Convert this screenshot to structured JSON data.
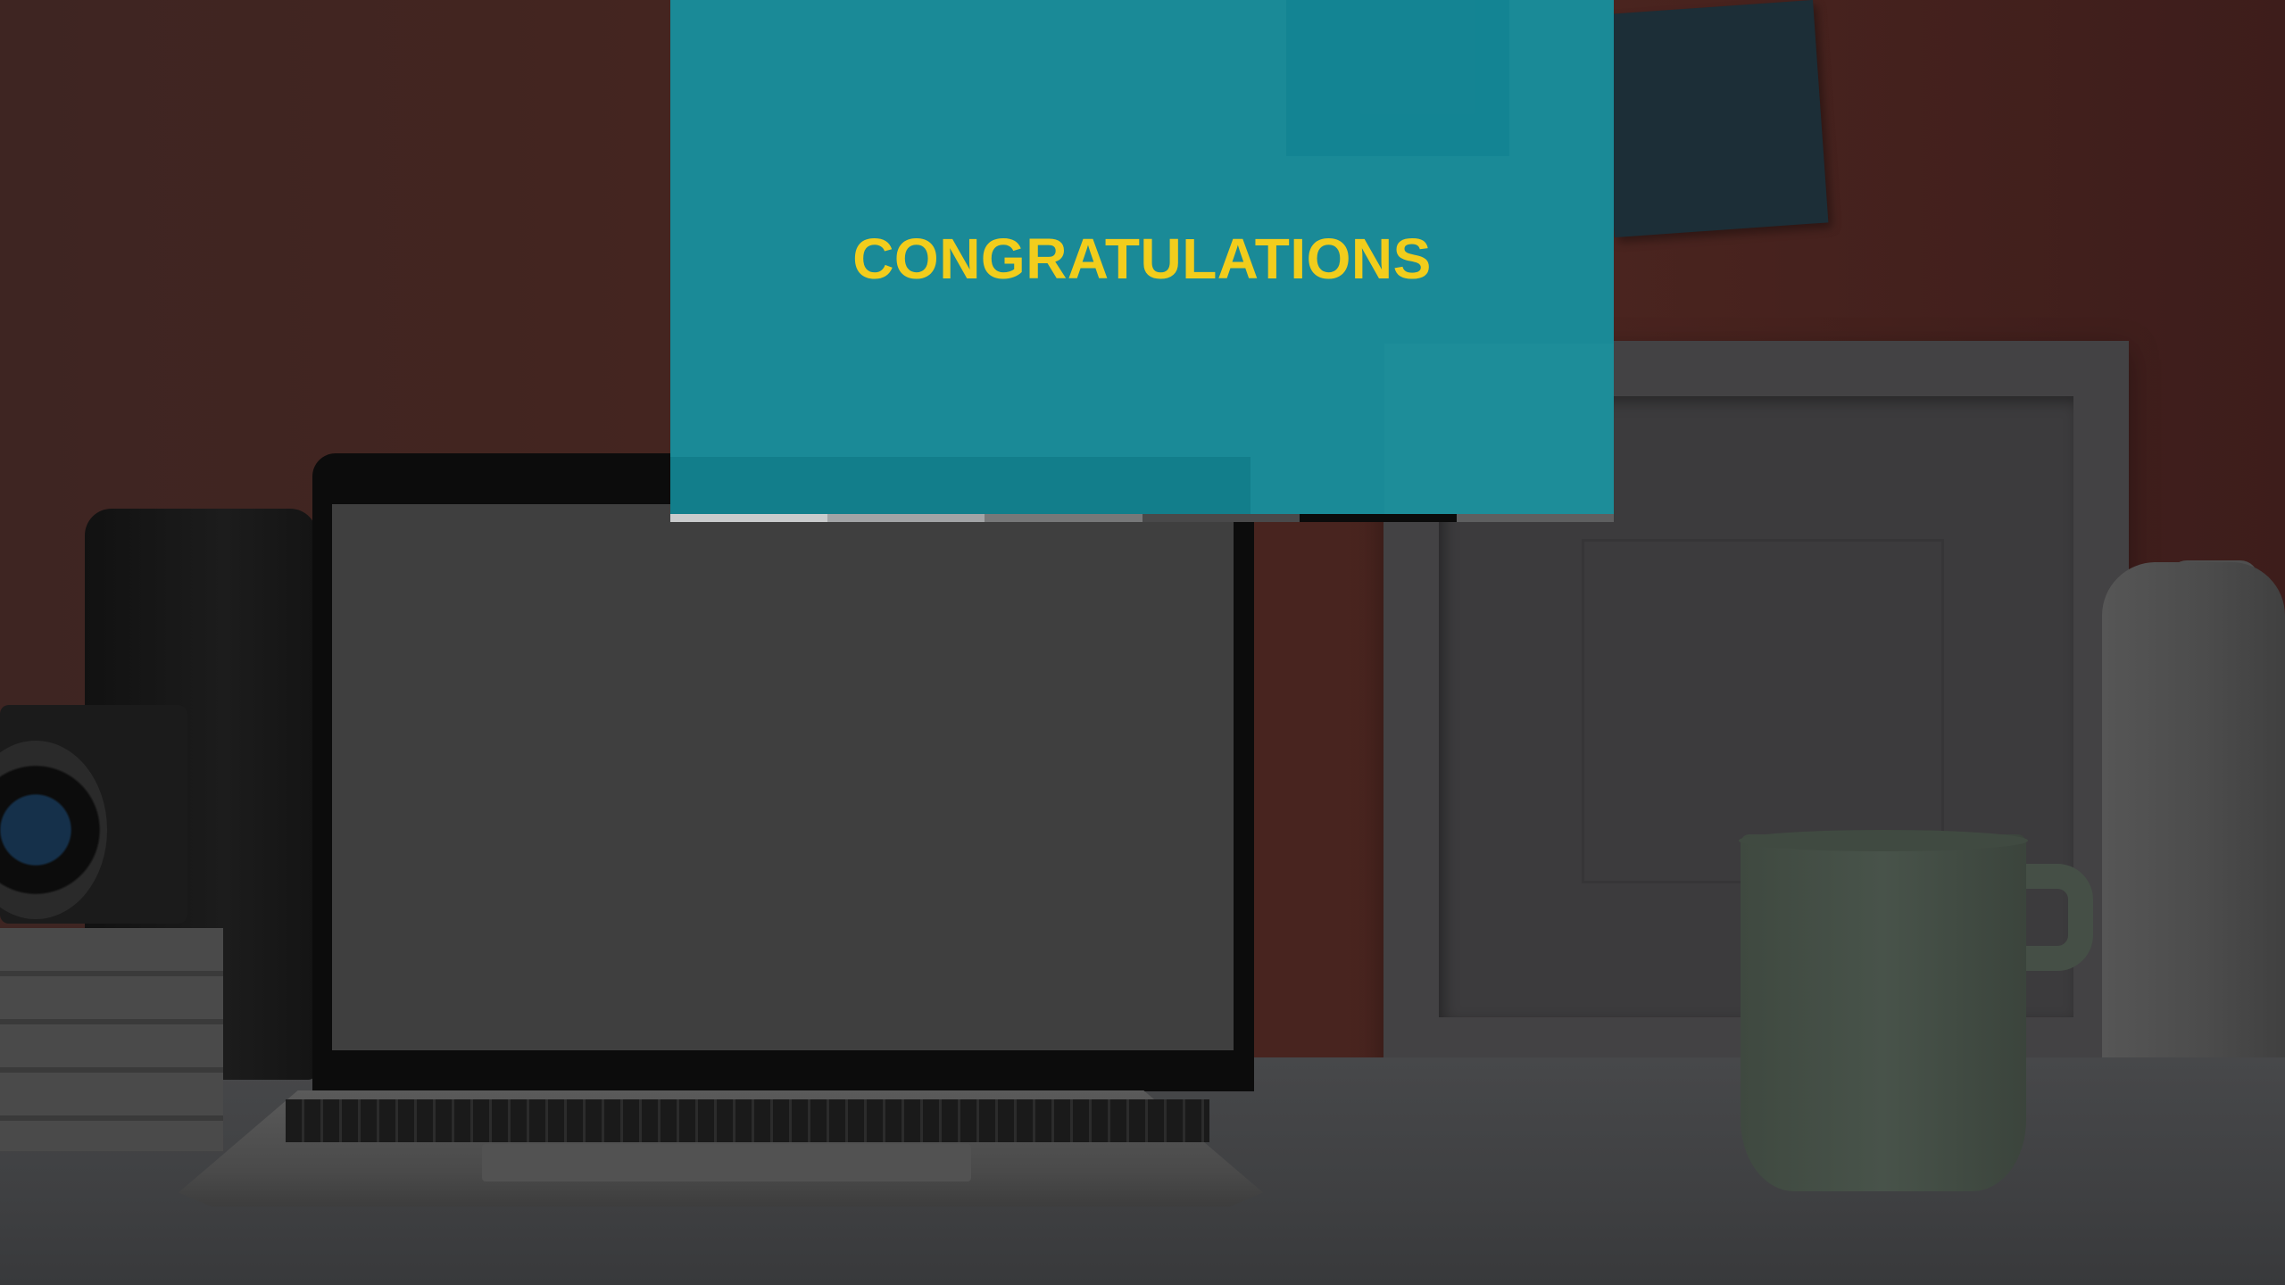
{
  "banner": {
    "title": "CONGRATULATIONS",
    "background_color": "#1a8a97",
    "title_color": "#f2cd1c"
  },
  "progress_segments": [
    {
      "color": "#c9cbcc"
    },
    {
      "color": "#a2a4a6"
    },
    {
      "color": "#777879"
    },
    {
      "color": "#49494a"
    },
    {
      "color": "#0b0b0b"
    },
    {
      "color": "#5e5f60"
    }
  ],
  "background": {
    "description_objects": [
      "wall",
      "laptop",
      "camera",
      "books",
      "picture-frame",
      "mug",
      "vase",
      "sticky-note"
    ]
  }
}
